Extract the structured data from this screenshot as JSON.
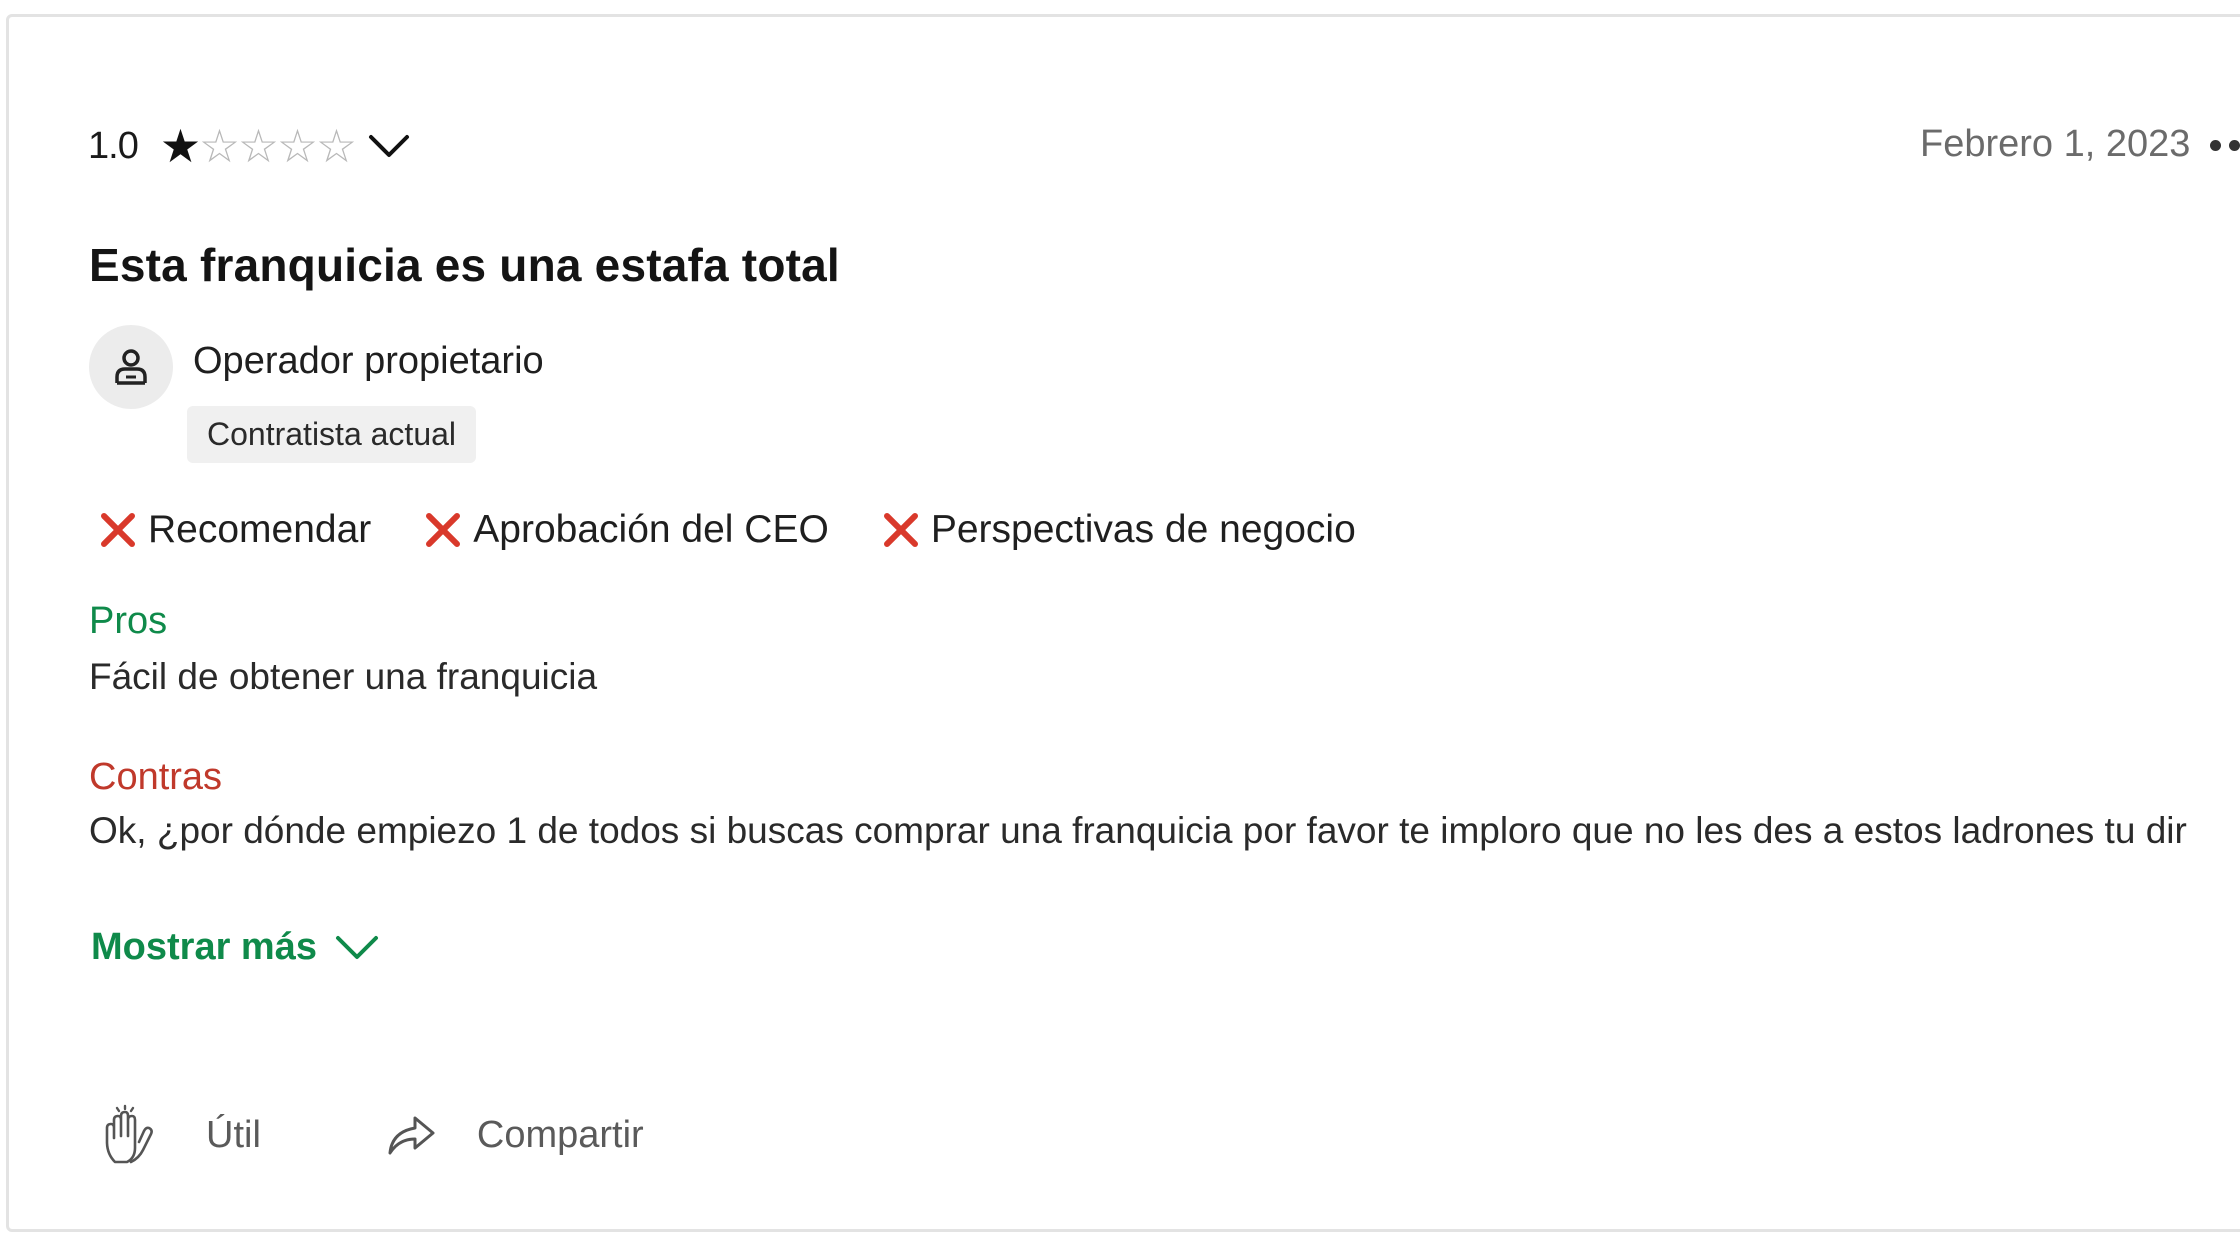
{
  "review": {
    "rating_value": "1.0",
    "rating_stars": 1,
    "rating_max": 5,
    "date": "Febrero 1, 2023",
    "title": "Esta franquicia es una estafa total",
    "job_title": "Operador propietario",
    "status": "Contratista actual",
    "indicators": [
      {
        "label": "Recomendar",
        "icon": "x-icon",
        "state": "negative"
      },
      {
        "label": "Aprobación del CEO",
        "icon": "x-icon",
        "state": "negative"
      },
      {
        "label": "Perspectivas de negocio",
        "icon": "x-icon",
        "state": "negative"
      }
    ],
    "pros_label": "Pros",
    "pros_text": "Fácil de obtener una franquicia",
    "cons_label": "Contras",
    "cons_text": "Ok, ¿por dónde empiezo 1 de todos si buscas comprar una franquicia por favor te imploro que no les des a estos ladrones tu dir",
    "show_more_label": "Mostrar más",
    "helpful_label": "Útil",
    "share_label": "Compartir"
  },
  "colors": {
    "pros": "#0f8a4a",
    "cons": "#c0392b",
    "negative_icon": "#d9392b",
    "accent": "#0f8a4a"
  },
  "icons": {
    "rating_toggle": "chevron-down-icon",
    "more_options": "more-dots-icon",
    "avatar": "user-icon",
    "show_more": "chevron-down-icon",
    "helpful": "clapping-hands-icon",
    "share": "share-arrow-icon"
  }
}
